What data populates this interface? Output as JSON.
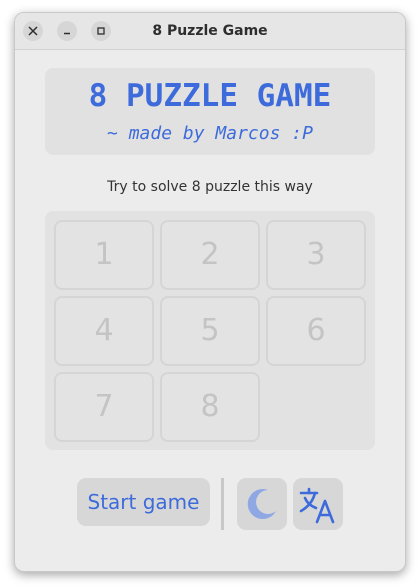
{
  "window": {
    "title": "8 Puzzle Game",
    "controls": {
      "close_glyph": "✕",
      "minimize_glyph": "–",
      "maximize_glyph": "□"
    }
  },
  "header": {
    "title": "8 PUZZLE GAME",
    "subtitle": "~ made by Marcos :P"
  },
  "instruction": "Try to solve 8 puzzle this way",
  "board": {
    "tiles": [
      "1",
      "2",
      "3",
      "4",
      "5",
      "6",
      "7",
      "8",
      ""
    ]
  },
  "controls": {
    "start_label": "Start game",
    "theme_icon": "moon-icon",
    "language_icon": "translate-icon"
  },
  "colors": {
    "accent": "#3d6bdc",
    "tile_text": "#c4c4c4",
    "icon_fill": "#8fa8e4"
  }
}
